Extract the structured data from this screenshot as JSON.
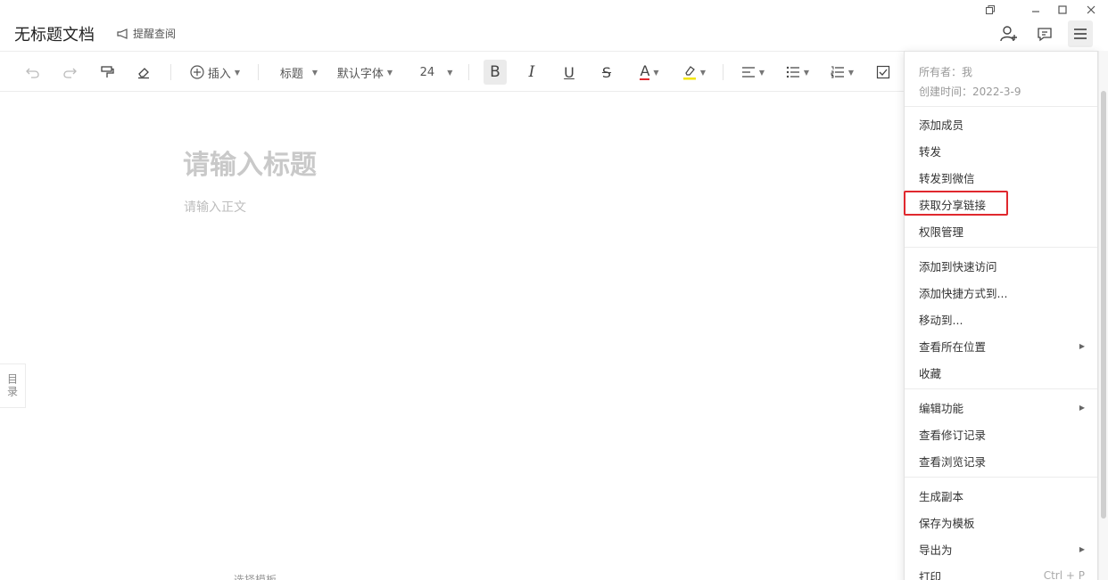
{
  "window": {
    "title": "无标题文档",
    "remind_label": "提醒查阅",
    "controls": [
      "restore-icon",
      "minimize-icon",
      "maximize-icon",
      "close-icon"
    ]
  },
  "header_icons": [
    "add-user-icon",
    "comment-icon",
    "menu-icon"
  ],
  "toolbar": {
    "insert_label": "插入",
    "heading_label": "标题",
    "font_label": "默认字体",
    "size_label": "24",
    "bold": "B",
    "italic": "I",
    "underline": "U",
    "strike": "S",
    "font_color": "A",
    "font_color_hex": "#e0282e",
    "highlight_hex": "#f2e500"
  },
  "editor": {
    "title_placeholder": "请输入标题",
    "body_placeholder": "请输入正文",
    "toc_label": "目录",
    "template_hint": "选择模板"
  },
  "menu": {
    "owner": "所有者：我",
    "created": "创建时间：2022-3-9",
    "groups": [
      [
        {
          "label": "添加成员"
        },
        {
          "label": "转发"
        },
        {
          "label": "转发到微信"
        },
        {
          "label": "获取分享链接",
          "highlighted": true
        },
        {
          "label": "权限管理"
        }
      ],
      [
        {
          "label": "添加到快速访问"
        },
        {
          "label": "添加快捷方式到..."
        },
        {
          "label": "移动到..."
        },
        {
          "label": "查看所在位置",
          "submenu": true
        },
        {
          "label": "收藏"
        }
      ],
      [
        {
          "label": "编辑功能",
          "submenu": true
        },
        {
          "label": "查看修订记录"
        },
        {
          "label": "查看浏览记录"
        }
      ],
      [
        {
          "label": "生成副本"
        },
        {
          "label": "保存为模板"
        },
        {
          "label": "导出为",
          "submenu": true
        },
        {
          "label": "打印",
          "shortcut": "Ctrl + P"
        }
      ]
    ],
    "highlight_color": "#e0282e"
  }
}
